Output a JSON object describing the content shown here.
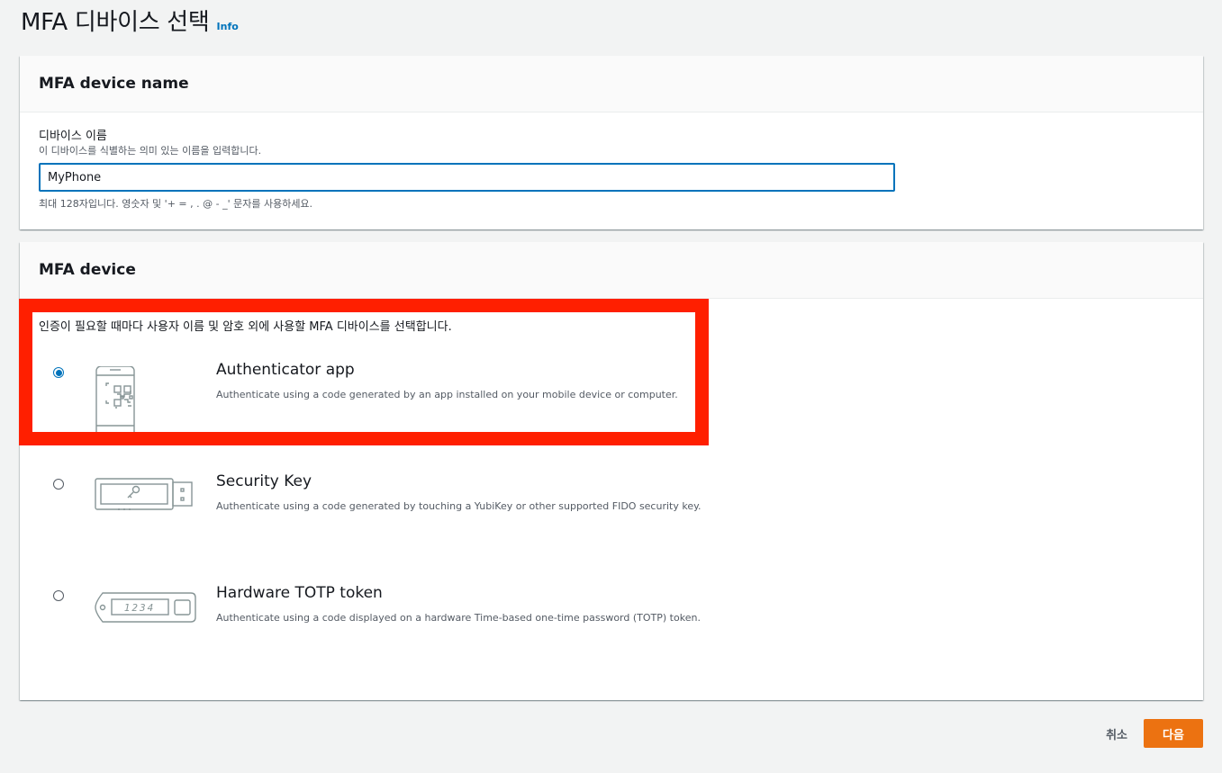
{
  "page": {
    "title": "MFA 디바이스 선택",
    "info_link": "Info"
  },
  "name_section": {
    "header": "MFA device name",
    "label": "디바이스 이름",
    "description": "이 디바이스를 식별하는 의미 있는 이름을 입력합니다.",
    "value": "MyPhone",
    "constraint": "최대 128자입니다. 영숫자 및 '+ = , . @ - _' 문자를 사용하세요."
  },
  "device_section": {
    "header": "MFA device",
    "description": "인증이 필요할 때마다 사용자 이름 및 암호 외에 사용할 MFA 디바이스를 선택합니다.",
    "options": [
      {
        "title": "Authenticator app",
        "description": "Authenticate using a code generated by an app installed on your mobile device or computer.",
        "icon": "authenticator-app-icon",
        "selected": true
      },
      {
        "title": "Security Key",
        "description": "Authenticate using a code generated by touching a YubiKey or other supported FIDO security key.",
        "icon": "security-key-icon",
        "selected": false
      },
      {
        "title": "Hardware TOTP token",
        "description": "Authenticate using a code displayed on a hardware Time-based one-time password (TOTP) token.",
        "icon": "hardware-token-icon",
        "selected": false,
        "display_digits": "1234"
      }
    ]
  },
  "actions": {
    "cancel": "취소",
    "next": "다음"
  },
  "colors": {
    "primary_button": "#ec7211",
    "link": "#0073bb",
    "highlight": "#ff1f00"
  }
}
